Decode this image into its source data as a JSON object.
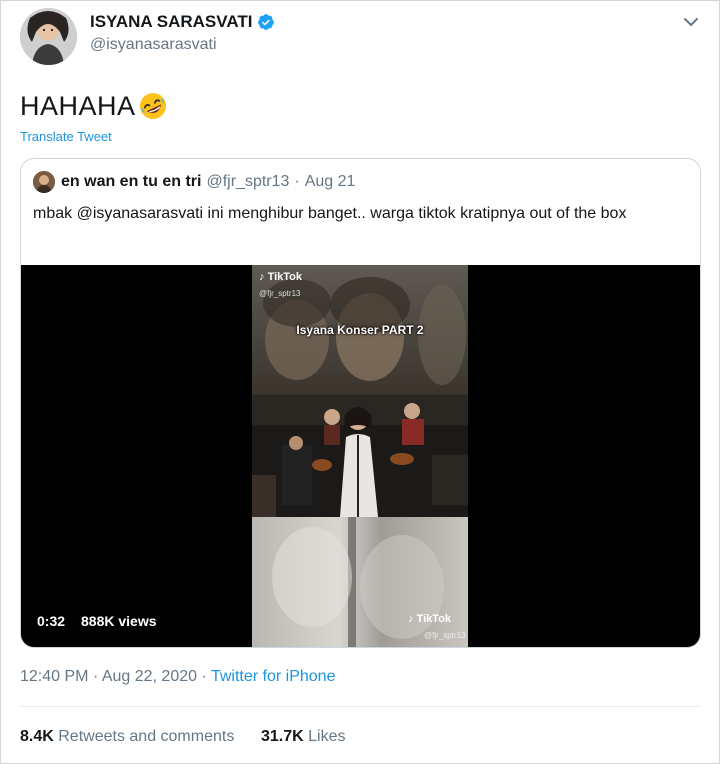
{
  "user": {
    "display_name": "ISYANA SARASVATI",
    "handle": "@isyanasarasvati"
  },
  "tweet": {
    "text": "HAHAHA",
    "emoji": "rolling-on-floor-laughing",
    "translate_label": "Translate Tweet"
  },
  "quoted": {
    "name": "en wan en tu en tri",
    "handle": "@fjr_sptr13",
    "separator": "·",
    "date": "Aug 21",
    "text": "mbak @isyanasarasvati ini menghibur banget.. warga tiktok kratipnya out of the box",
    "video": {
      "watermark_top": "TikTok",
      "watermark_user": "@fjr_sptr13",
      "caption": "Isyana Konser PART 2",
      "watermark_bottom": "TikTok",
      "watermark_user_bottom": "@fjr_sptr13",
      "duration": "0:32",
      "views": "888K views"
    }
  },
  "meta": {
    "time": "12:40 PM",
    "separator": "·",
    "date": "Aug 22, 2020",
    "separator2": "·",
    "source": "Twitter for iPhone"
  },
  "stats": {
    "retweets_count": "8.4K",
    "retweets_label": "Retweets and comments",
    "likes_count": "31.7K",
    "likes_label": "Likes"
  },
  "colors": {
    "accent": "#1b95e0",
    "verified": "#1da1f2",
    "muted": "#657786"
  }
}
